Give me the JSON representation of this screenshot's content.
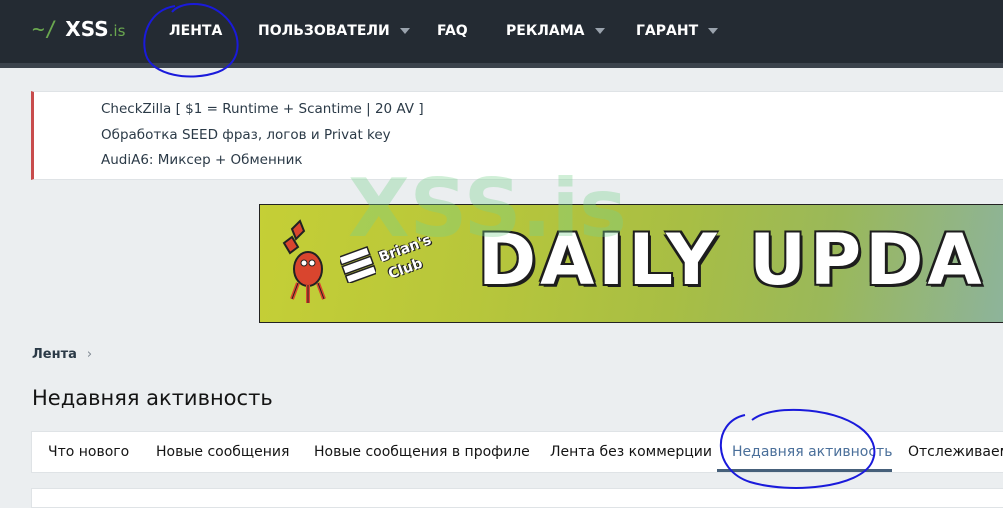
{
  "header": {
    "logo_tilde": "~/",
    "logo_name": "XSS",
    "logo_tld": ".is",
    "nav": [
      {
        "label": "ЛЕНТА",
        "has_dropdown": false
      },
      {
        "label": "ПОЛЬЗОВАТЕЛИ",
        "has_dropdown": true
      },
      {
        "label": "FAQ",
        "has_dropdown": false
      },
      {
        "label": "РЕКЛАМА",
        "has_dropdown": true
      },
      {
        "label": "ГАРАНТ",
        "has_dropdown": true
      }
    ]
  },
  "notice": {
    "lines": [
      "CheckZilla [ $1 = Runtime + Scantime | 20 AV ]",
      "Обработка SEED фраз, логов и Privat key",
      "AudiA6: Миксер + Обменник"
    ]
  },
  "banner": {
    "logo_line1": "Brian's",
    "logo_line2": "Club",
    "headline": "DAILY UPDA"
  },
  "watermark": "XSS.is",
  "breadcrumb": {
    "items": [
      "Лента"
    ]
  },
  "page": {
    "title": "Недавняя активность"
  },
  "tabs": {
    "items": [
      {
        "label": "Что нового",
        "active": false
      },
      {
        "label": "Новые сообщения",
        "active": false
      },
      {
        "label": "Новые сообщения в профиле",
        "active": false
      },
      {
        "label": "Лента без коммерции",
        "active": false
      },
      {
        "label": "Недавняя активность",
        "active": true
      },
      {
        "label": "Отслеживаемы",
        "active": false
      }
    ]
  },
  "colors": {
    "topbar": "#242b33",
    "accent_green": "#6aa84f",
    "notice_border": "#c84c4c",
    "active_tab": "#4a6f9a",
    "annotation_circle": "#1a1adb"
  }
}
